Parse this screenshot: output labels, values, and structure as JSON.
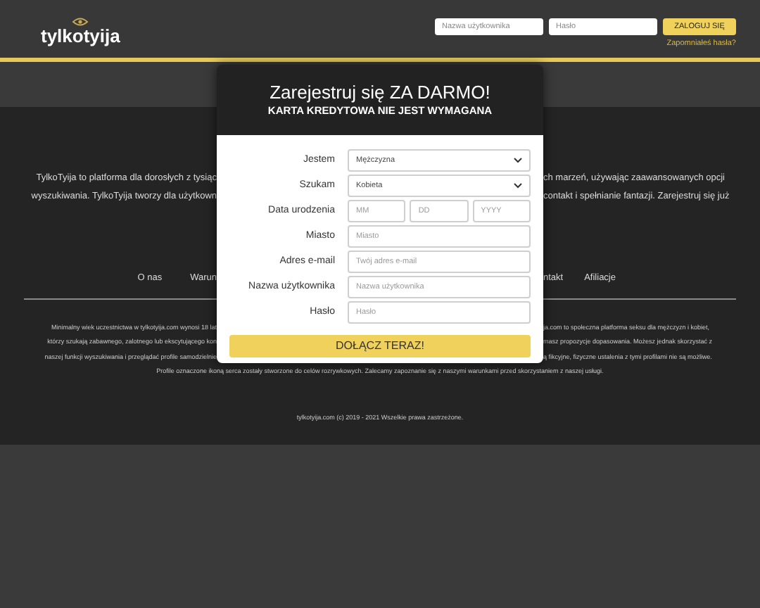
{
  "header": {
    "logo": "tylkotyija",
    "login": {
      "username_placeholder": "Nazwa użytkownika",
      "password_placeholder": "Hasło",
      "button": "ZALOGUJ SIĘ",
      "forgot_link": "Zapomniałeś hasła?"
    }
  },
  "intro_lines": [
    {
      "left": "TylkoTyija to platforma dla dorosłych z tysiąc",
      "right": "ch marzeń, używając zaawansowanych opcji"
    },
    {
      "left": "wyszukiwania. TylkoTyija tworzy dla użytkown",
      "right": "contakt i spełnianie fantazji. Zarejestruj się już"
    }
  ],
  "footer_links": {
    "left": [
      "O nas",
      "Warun"
    ],
    "right": [
      "ntakt",
      "Afiliacje"
    ]
  },
  "fine_print": [
    {
      "left": "Minimalny wiek uczestnictwa w tylkotyija.com wynosi 18 lat",
      "right": "ja.com to społeczna platforma seksu dla mężczyzn i kobiet,"
    },
    {
      "left": "którzy szukają zabawnego, zalotnego lub ekscytującego kon",
      "right": "masz propozycje dopasowania. Możesz jednak skorzystać z"
    },
    {
      "left": "naszej funkcji wyszukiwania i przeglądać profile samodzielnie",
      "right": "ą fikcyjne, fizyczne ustalenia z tymi profilami nie są możliwe."
    }
  ],
  "fine_print_last": "Profile oznaczone ikoną serca zostały stworzone do celów rozrywkowych. Zalecamy zapoznanie się z naszymi warunkami przed skorzystaniem z naszej usługi.",
  "copyright": "tylkotyija.com (c) 2019 - 2021 Wszelkie prawa zastrzeżone.",
  "modal": {
    "title": "Zarejestruj się ZA DARMO!",
    "subtitle": "KARTA KREDYTOWA NIE JEST WYMAGANA",
    "fields": [
      {
        "kind": "select",
        "label": "Jestem",
        "value": "Mężczyzna"
      },
      {
        "kind": "select",
        "label": "Szukam",
        "value": "Kobieta"
      },
      {
        "kind": "date",
        "label": "Data urodzenia",
        "placeholders": [
          "MM",
          "DD",
          "YYYY"
        ]
      },
      {
        "kind": "input",
        "label": "Miasto",
        "placeholder": "Miasto"
      },
      {
        "kind": "input",
        "label": "Adres e-mail",
        "placeholder": "Twój adres e-mail"
      },
      {
        "kind": "input",
        "label": "Nazwa użytkownika",
        "placeholder": "Nazwa użytkownika"
      },
      {
        "kind": "input",
        "label": "Hasło",
        "placeholder": "Hasło"
      }
    ],
    "button": "DOŁĄCZ TERAZ!"
  }
}
